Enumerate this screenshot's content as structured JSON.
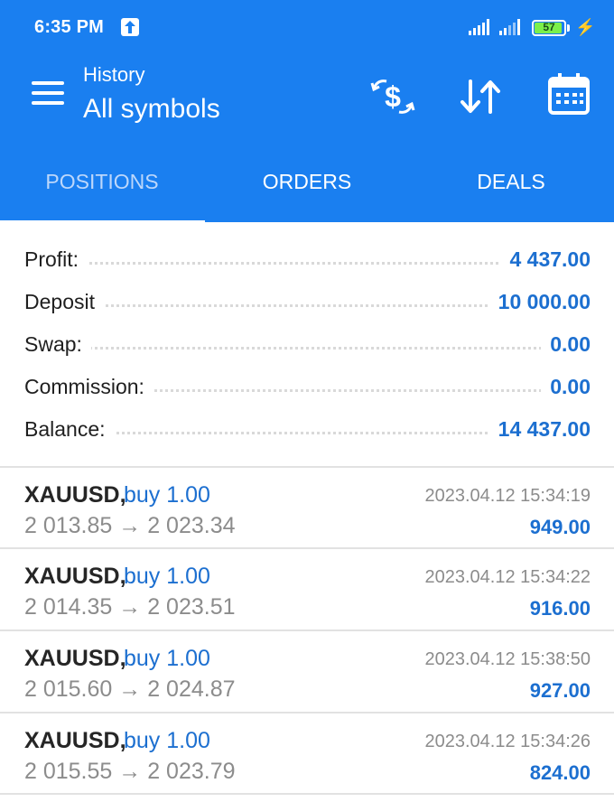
{
  "status_bar": {
    "time": "6:35 PM",
    "battery": "57"
  },
  "app_bar": {
    "title": "History",
    "subtitle": "All symbols"
  },
  "tabs": [
    {
      "label": "POSITIONS",
      "active": false
    },
    {
      "label": "ORDERS",
      "active": false
    },
    {
      "label": "DEALS",
      "active": false
    }
  ],
  "summary": {
    "profit": {
      "label": "Profit:",
      "value": "4 437.00"
    },
    "deposit": {
      "label": "Deposit",
      "value": "10 000.00"
    },
    "swap": {
      "label": "Swap:",
      "value": "0.00"
    },
    "commission": {
      "label": "Commission:",
      "value": "0.00"
    },
    "balance": {
      "label": "Balance:",
      "value": "14 437.00"
    }
  },
  "deals": [
    {
      "symbol": "XAUUSD,",
      "side": "buy 1.00",
      "prices": "2 013.85 → 2 023.34",
      "time": "2023.04.12 15:34:19",
      "profit": "949.00"
    },
    {
      "symbol": "XAUUSD,",
      "side": "buy 1.00",
      "prices": "2 014.35 → 2 023.51",
      "time": "2023.04.12 15:34:22",
      "profit": "916.00"
    },
    {
      "symbol": "XAUUSD,",
      "side": "buy 1.00",
      "prices": "2 015.60 → 2 024.87",
      "time": "2023.04.12 15:38:50",
      "profit": "927.00"
    },
    {
      "symbol": "XAUUSD,",
      "side": "buy 1.00",
      "prices": "2 015.55 → 2 023.79",
      "time": "2023.04.12 15:34:26",
      "profit": "824.00"
    }
  ],
  "icons": {
    "menu": "hamburger-menu-icon",
    "currency": "currency-exchange-icon",
    "sort": "sort-icon",
    "calendar": "calendar-icon"
  },
  "colors": {
    "header_bg": "#1a7ff0",
    "accent_value": "#1c6fd0",
    "muted_text": "#8c8c8c"
  }
}
